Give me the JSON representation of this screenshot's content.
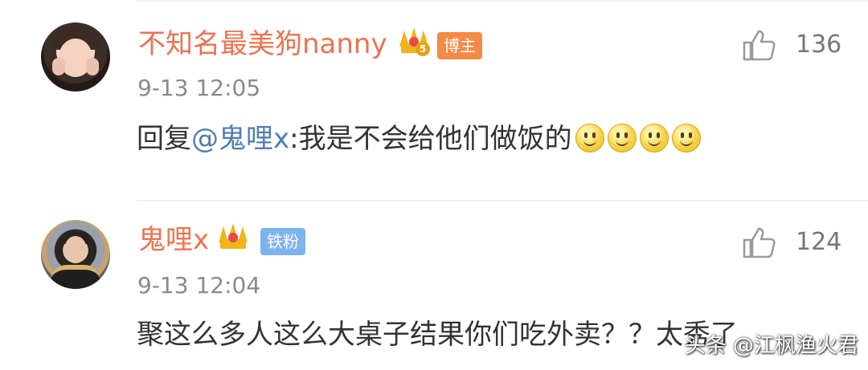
{
  "comments": [
    {
      "username": "不知名最美狗nanny",
      "crown_level": "5",
      "badge": "博主",
      "likes": "136",
      "time": "9-13 12:05",
      "content": {
        "reply_prefix": "回复",
        "mention": "@鬼哩x",
        "text": ":我是不会给他们做饭的"
      },
      "emoji_count": 4
    },
    {
      "username": "鬼哩x",
      "badge": "铁粉",
      "likes": "124",
      "time": "9-13 12:04",
      "content": {
        "text": "聚这么多人这么大桌子结果你们吃外卖？？太秀了"
      }
    }
  ],
  "watermark": "头条 @江枫渔火君",
  "colors": {
    "username": "#eb7350",
    "mention": "#507daf",
    "badge_blogger": "#f48a45",
    "badge_fan": "#7eb4ee",
    "crown": "#f2b41c"
  },
  "icons": [
    "thumbs-up-icon",
    "crown-icon",
    "smile-emoji-icon"
  ]
}
